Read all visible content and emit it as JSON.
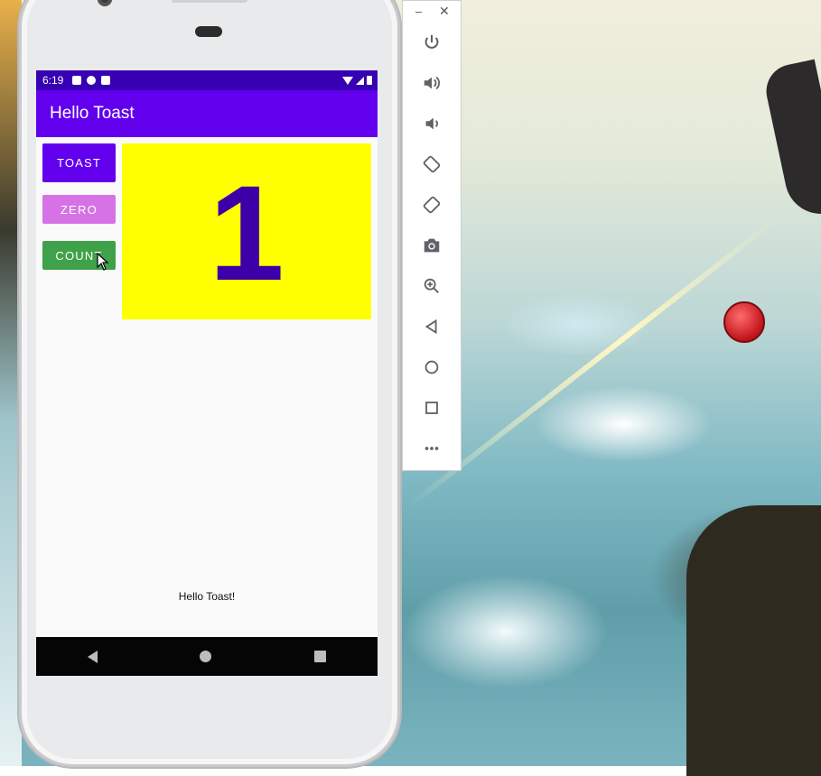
{
  "app": {
    "title": "Hello Toast",
    "status_time": "6:19"
  },
  "buttons": {
    "toast_label": "TOAST",
    "zero_label": "ZERO",
    "count_label": "COUNT"
  },
  "counter": {
    "value": "1"
  },
  "message": {
    "text": "Hello Toast!"
  },
  "colors": {
    "app_bar": "#6200ee",
    "status_bar": "#3700b3",
    "toast_button": "#6200ee",
    "zero_button": "#d672e6",
    "count_button": "#3fa24a",
    "count_background": "#ffff00",
    "count_text": "#3d00a8"
  },
  "emulator_toolbar": {
    "window_controls": [
      "minimize-icon",
      "close-icon"
    ],
    "items": [
      "power-icon",
      "volume-up-icon",
      "volume-down-icon",
      "rotate-left-icon",
      "rotate-right-icon",
      "camera-icon",
      "zoom-icon",
      "back-icon",
      "home-icon",
      "overview-icon",
      "more-icon"
    ]
  }
}
